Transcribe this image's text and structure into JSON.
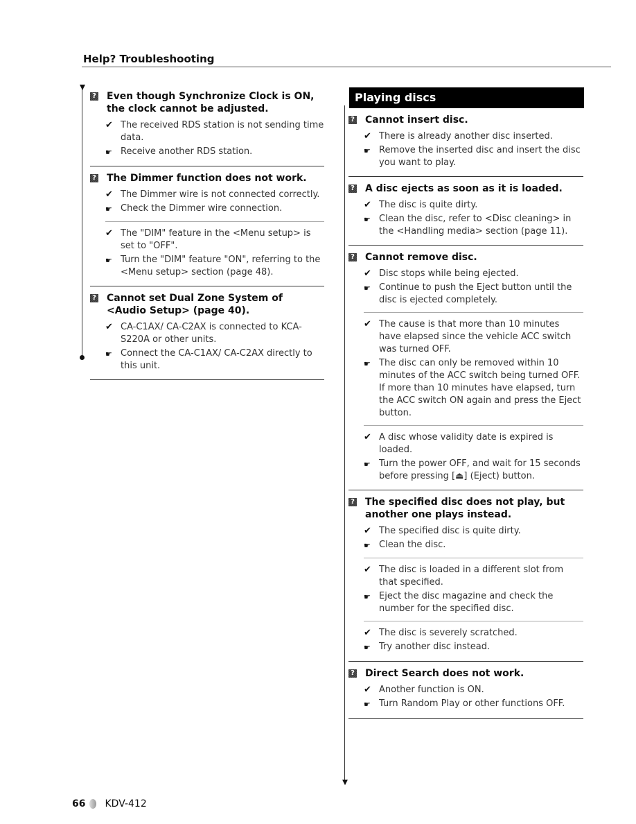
{
  "header": {
    "title": "Help? Troubleshooting"
  },
  "icons": {
    "question": "?",
    "cause": "✔",
    "remedy": "☛"
  },
  "left": {
    "entries": [
      {
        "question": "Even though Synchronize Clock is ON, the clock cannot be adjusted.",
        "subs": [
          {
            "cause": "The received RDS station is not sending time data.",
            "remedy": "Receive another RDS station."
          }
        ]
      },
      {
        "question": "The Dimmer function does not work.",
        "subs": [
          {
            "cause": "The Dimmer wire is not connected correctly.",
            "remedy": "Check the Dimmer wire connection."
          },
          {
            "cause": "The \"DIM\" feature in the <Menu setup> is set to \"OFF\".",
            "remedy": "Turn the \"DIM\" feature \"ON\", referring to the <Menu setup> section (page 48)."
          }
        ]
      },
      {
        "question": "Cannot set Dual Zone System of <Audio Setup> (page 40).",
        "subs": [
          {
            "cause": "CA-C1AX/ CA-C2AX is connected to KCA-S220A or other units.",
            "remedy": "Connect the CA-C1AX/ CA-C2AX directly to this unit."
          }
        ]
      }
    ]
  },
  "right": {
    "section_title": "Playing discs",
    "entries": [
      {
        "question": "Cannot insert disc.",
        "subs": [
          {
            "cause": "There is already another disc inserted.",
            "remedy": "Remove the inserted disc and insert the disc you want to play."
          }
        ]
      },
      {
        "question": "A disc ejects as soon as it is loaded.",
        "subs": [
          {
            "cause": "The disc is quite dirty.",
            "remedy": "Clean the disc, refer to <Disc cleaning> in the <Handling media> section (page 11)."
          }
        ]
      },
      {
        "question": "Cannot remove disc.",
        "subs": [
          {
            "cause": "Disc stops while being ejected.",
            "remedy": "Continue to push the Eject button until the disc is ejected completely."
          },
          {
            "cause": "The cause is that more than 10 minutes have elapsed since the vehicle ACC switch was turned OFF.",
            "remedy": "The disc can only be removed within 10 minutes of the ACC switch being turned OFF. If more than 10 minutes have elapsed, turn the ACC switch ON again and press the Eject button."
          },
          {
            "cause": "A disc whose validity date is expired is loaded.",
            "remedy": "Turn the power OFF, and wait for 15 seconds before pressing [⏏] (Eject) button."
          }
        ]
      },
      {
        "question": "The specified disc does not play, but another one plays instead.",
        "subs": [
          {
            "cause": "The specified disc is quite dirty.",
            "remedy": "Clean the disc."
          },
          {
            "cause": "The disc is loaded in a different slot from that specified.",
            "remedy": "Eject the disc magazine and check the number for the specified disc."
          },
          {
            "cause": "The disc is severely scratched.",
            "remedy": "Try another disc instead."
          }
        ]
      },
      {
        "question": "Direct Search does not work.",
        "subs": [
          {
            "cause": "Another function is ON.",
            "remedy": "Turn Random Play or other functions OFF."
          }
        ]
      }
    ]
  },
  "footer": {
    "page_number": "66",
    "model": "KDV-412"
  }
}
